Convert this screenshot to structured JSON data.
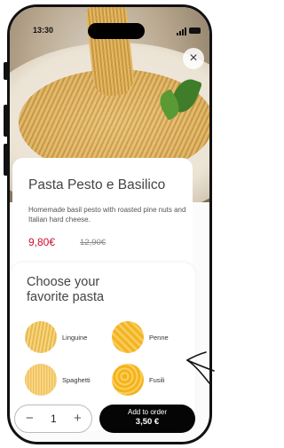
{
  "status_bar": {
    "time": "13:30"
  },
  "product": {
    "title": "Pasta Pesto e Basilico",
    "description": "Homemade basil pesto with roasted pine nuts and Italian hard cheese.",
    "price": "9,80€",
    "old_price": "12,90€",
    "image": "pasta-plate-photo"
  },
  "chooser": {
    "title": "Choose your favorite pasta",
    "options": [
      {
        "label": "Linguine",
        "icon": "linguine-photo"
      },
      {
        "label": "Penne",
        "icon": "penne-photo"
      },
      {
        "label": "Spaghetti",
        "icon": "spaghetti-photo"
      },
      {
        "label": "Fusili",
        "icon": "fusili-photo"
      }
    ]
  },
  "bottom_bar": {
    "quantity": "1",
    "minus": "−",
    "plus": "+",
    "add_label": "Add to order",
    "add_price": "3,50 €"
  },
  "icons": {
    "close": "×"
  },
  "colors": {
    "price": "#c8102e",
    "button": "#050505"
  }
}
